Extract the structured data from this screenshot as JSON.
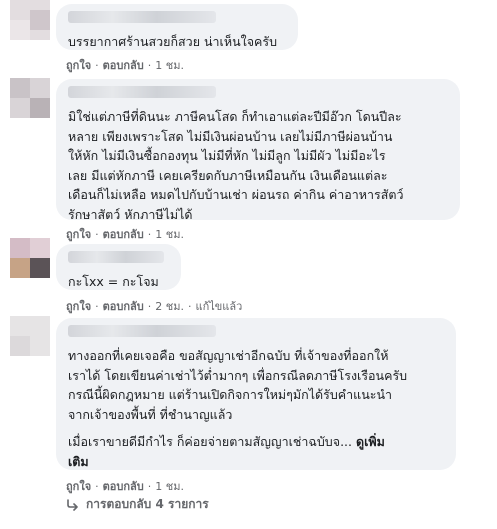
{
  "comments": [
    {
      "text": "บรรยากาศร้านสวยก็สวย น่าเห็นใจครับ",
      "actions": {
        "like": "ถูกใจ",
        "reply": "ตอบกลับ",
        "time": "1 ชม."
      }
    },
    {
      "text": "มิใช่แต่ภาษีที่ดินนะ ภาษีคนโสด ก็ทำเอาแต่ละปีมีอ๊วก โดนปีละ\nหลาย เพียงเพราะโสด ไม่มีเงินผ่อนบ้าน เลยไม่มีภาษีผ่อนบ้าน\nให้หัก ไม่มีเงินซื้อกองทุน ไม่มีที่หัก ไม่มีลูก ไม่มีผัว ไม่มีอะไร\nเลย มีแต่หักภาษี เคยเครียดกับภาษีเหมือนกัน เงินเดือนแต่ละ\nเดือนก็ไม่เหลือ หมดไปกับบ้านเช่า ผ่อนรถ ค่ากิน ค่าอาหารสัตว์\nรักษาสัตว์ หักภาษีไม่ได้",
      "actions": {
        "like": "ถูกใจ",
        "reply": "ตอบกลับ",
        "time": "1 ชม."
      }
    },
    {
      "text": "กะโxx = กะโจม",
      "actions": {
        "like": "ถูกใจ",
        "reply": "ตอบกลับ",
        "time": "2 ชม.",
        "edited": "แก้ไขแล้ว"
      }
    },
    {
      "text": "ทางออกที่เคยเจอคือ ขอสัญญาเช่าอีกฉบับ ที่เจ้าของที่ออกให้\nเราได้ โดยเขียนค่าเช่าไว้ต่ำมากๆ เพื่อกรณีลดภาษีโรงเรือนครับ\nกรณีนี้ผิดกฎหมาย แต่ร้านเปิดกิจการใหม่ๆมักได้รับคำแนะนำ\nจากเจ้าของพื้นที่ ที่ชำนาญแล้ว",
      "text2": "เมื่อเราขายดีมีกำไร ก็ค่อยจ่ายตามสัญญาเช่าฉบับจ...",
      "more_label": "ดูเพิ่ม\nเติม",
      "actions": {
        "like": "ถูกใจ",
        "reply": "ตอบกลับ",
        "time": "1 ชม."
      }
    }
  ],
  "view_replies": "การตอบกลับ 4 รายการ",
  "icons": {
    "reply_arrow": "reply-arrow-icon"
  }
}
